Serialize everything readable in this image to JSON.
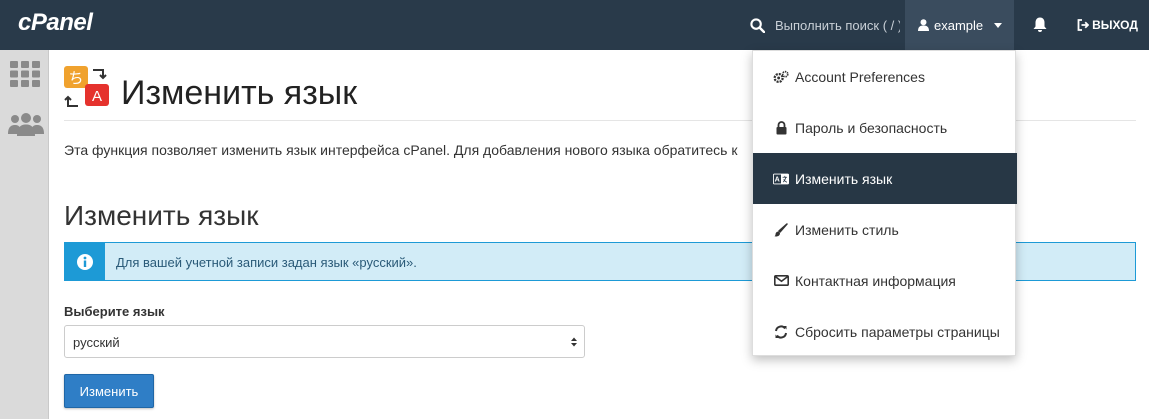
{
  "brand": {
    "logo": "cPanel"
  },
  "topbar": {
    "search_placeholder": "Выполнить поиск ( / )",
    "username": "example",
    "logout_label": "ВЫХОД"
  },
  "page": {
    "title": "Изменить язык",
    "description": "Эта функция позволяет изменить язык интерфейса cPanel. Для добавления нового языка обратитесь к",
    "section_title": "Изменить язык",
    "alert_text": "Для вашей учетной записи задан язык «русский».",
    "select_label": "Выберите язык",
    "select_value": "русский",
    "submit_label": "Изменить"
  },
  "page_icon_glyphs": {
    "left": "ち",
    "right": "A"
  },
  "dropdown": {
    "items": [
      {
        "label": "Account Preferences",
        "icon": "gears-icon"
      },
      {
        "label": "Пароль и безопасность",
        "icon": "lock-icon"
      },
      {
        "label": "Изменить язык",
        "icon": "language-icon",
        "active": true
      },
      {
        "label": "Изменить стиль",
        "icon": "paintbrush-icon"
      },
      {
        "label": "Контактная информация",
        "icon": "envelope-icon"
      },
      {
        "label": "Сбросить параметры страницы",
        "icon": "refresh-icon"
      }
    ]
  },
  "colors": {
    "topbar": "#293a4a",
    "user_menu_bg": "#3a4c5e",
    "active_item": "#273745",
    "alert_bg": "#d2ecf7",
    "alert_border": "#1d9ad6",
    "button": "#2f7ec6"
  }
}
